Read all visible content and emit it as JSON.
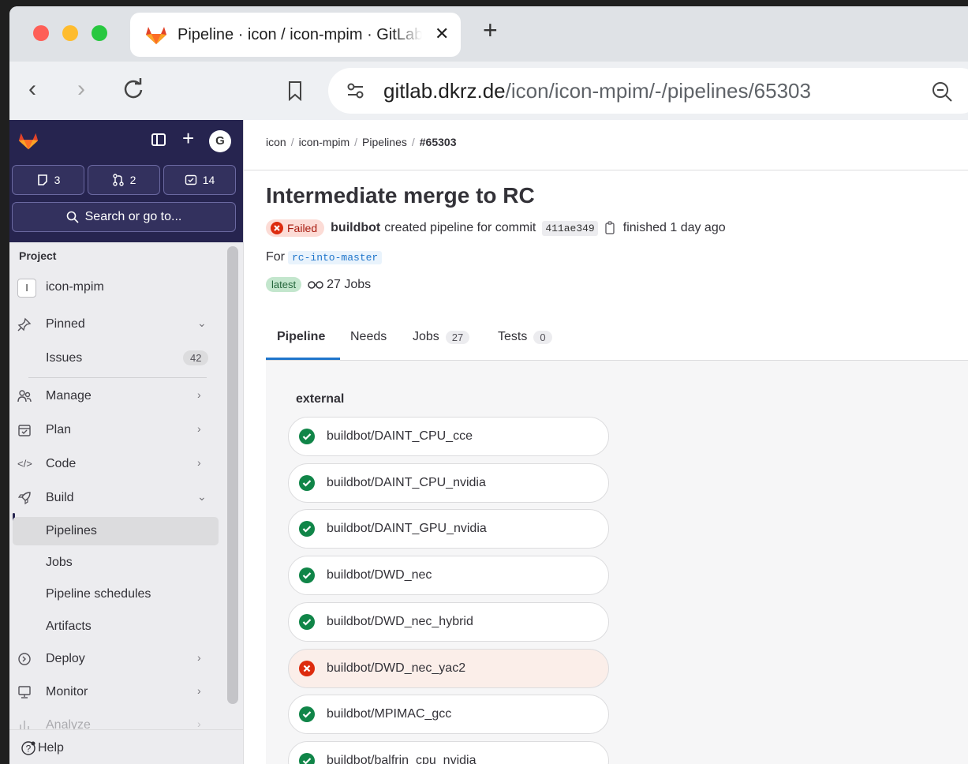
{
  "browser": {
    "tab_title": "Pipeline · icon / icon-mpim · GitLab",
    "url_host": "gitlab.dkrz.de",
    "url_path": "/icon/icon-mpim/-/pipelines/65303"
  },
  "sidebar": {
    "avatar_initial": "G",
    "counters": [
      {
        "icon": "issues-icon",
        "value": "3"
      },
      {
        "icon": "merge-request-icon",
        "value": "2"
      },
      {
        "icon": "todo-icon",
        "value": "14"
      }
    ],
    "search_label": "Search or go to...",
    "section_title": "Project",
    "project_badge": "I",
    "project_name": "icon-mpim",
    "items": [
      {
        "label": "Pinned"
      },
      {
        "label": "Issues",
        "count": "42"
      },
      {
        "label": "Manage"
      },
      {
        "label": "Plan"
      },
      {
        "label": "Code"
      },
      {
        "label": "Build"
      },
      {
        "label": "Pipelines"
      },
      {
        "label": "Jobs"
      },
      {
        "label": "Pipeline schedules"
      },
      {
        "label": "Artifacts"
      },
      {
        "label": "Deploy"
      },
      {
        "label": "Monitor"
      },
      {
        "label": "Analyze"
      }
    ],
    "help_label": "Help"
  },
  "breadcrumb": [
    "icon",
    "icon-mpim",
    "Pipelines",
    "#65303"
  ],
  "pipeline": {
    "title": "Intermediate merge to RC",
    "status": "Failed",
    "author": "buildbot",
    "created_text": "created pipeline for commit",
    "commit": "411ae349",
    "finished_text": "finished 1 day ago",
    "for_label": "For",
    "branch": "rc-into-master",
    "latest_badge": "latest",
    "jobs_summary": "27 Jobs"
  },
  "tabs": [
    {
      "label": "Pipeline"
    },
    {
      "label": "Needs"
    },
    {
      "label": "Jobs",
      "count": "27"
    },
    {
      "label": "Tests",
      "count": "0"
    }
  ],
  "stage": {
    "name": "external",
    "jobs": [
      {
        "name": "buildbot/DAINT_CPU_cce",
        "status": "success"
      },
      {
        "name": "buildbot/DAINT_CPU_nvidia",
        "status": "success"
      },
      {
        "name": "buildbot/DAINT_GPU_nvidia",
        "status": "success"
      },
      {
        "name": "buildbot/DWD_nec",
        "status": "success"
      },
      {
        "name": "buildbot/DWD_nec_hybrid",
        "status": "success"
      },
      {
        "name": "buildbot/DWD_nec_yac2",
        "status": "failed"
      },
      {
        "name": "buildbot/MPIMAC_gcc",
        "status": "success"
      },
      {
        "name": "buildbot/balfrin_cpu_nvidia",
        "status": "success"
      }
    ]
  },
  "colors": {
    "success": "#108548",
    "failed": "#dd2b0e",
    "sidebar_top": "#26244f",
    "link": "#1f75cb"
  }
}
